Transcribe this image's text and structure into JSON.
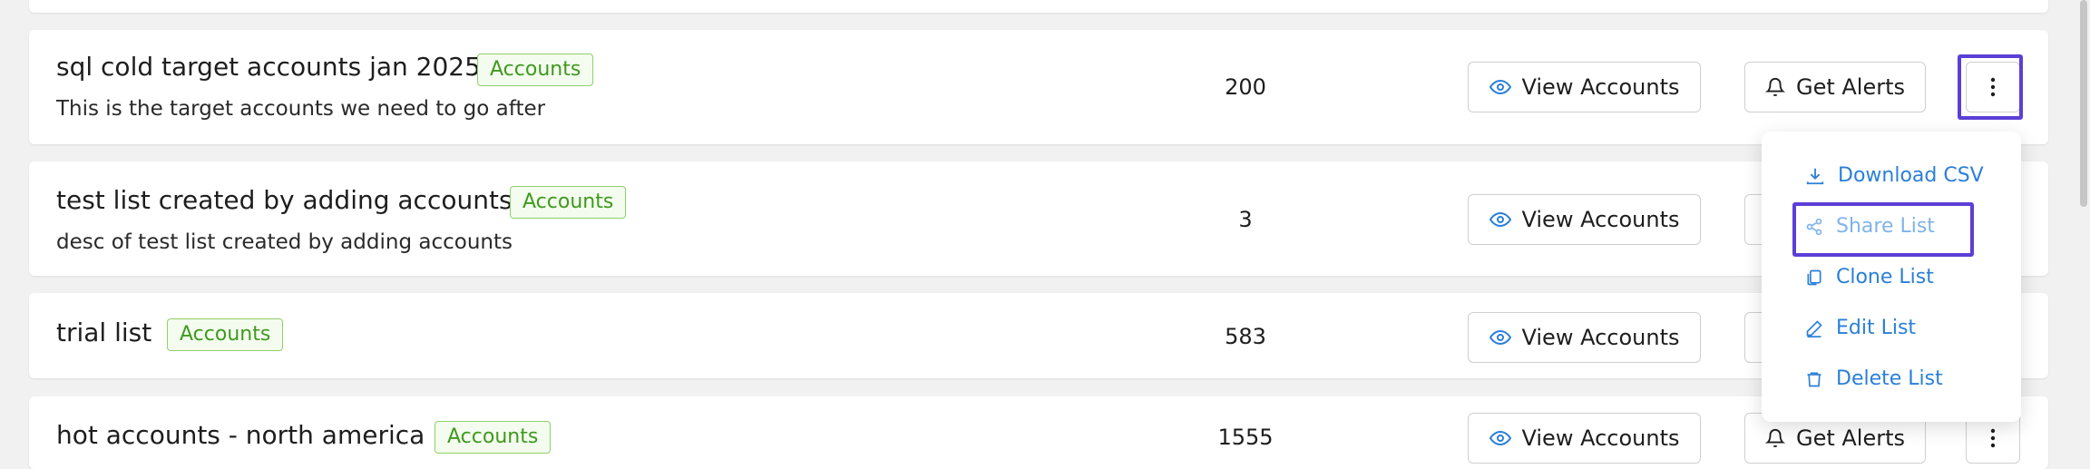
{
  "lists": [
    {
      "title": "sql cold target accounts jan 2025",
      "badge": "Accounts",
      "description": "This is the target accounts we need to go after",
      "count": "200",
      "view_label": "View Accounts",
      "alert_label": "Get Alerts"
    },
    {
      "title": "test list created by adding accounts",
      "badge": "Accounts",
      "description": "desc of test list created by adding accounts",
      "count": "3",
      "view_label": "View Accounts",
      "alert_label": ""
    },
    {
      "title": "trial list",
      "badge": "Accounts",
      "description": "",
      "count": "583",
      "view_label": "View Accounts",
      "alert_label": ""
    },
    {
      "title": "hot accounts - north america",
      "badge": "Accounts",
      "description": "",
      "count": "1555",
      "view_label": "View Accounts",
      "alert_label": "Get Alerts"
    }
  ],
  "menu": {
    "items": [
      {
        "label": "Download CSV",
        "icon": "download-icon"
      },
      {
        "label": "Share List",
        "icon": "share-icon"
      },
      {
        "label": "Clone List",
        "icon": "copy-icon"
      },
      {
        "label": "Edit List",
        "icon": "pencil-icon"
      },
      {
        "label": "Delete List",
        "icon": "trash-icon"
      }
    ]
  },
  "colors": {
    "accent": "#2a7fd8",
    "highlight": "#5b3fd6",
    "badge_text": "#3f9a1e",
    "badge_border": "#8fd16a"
  }
}
